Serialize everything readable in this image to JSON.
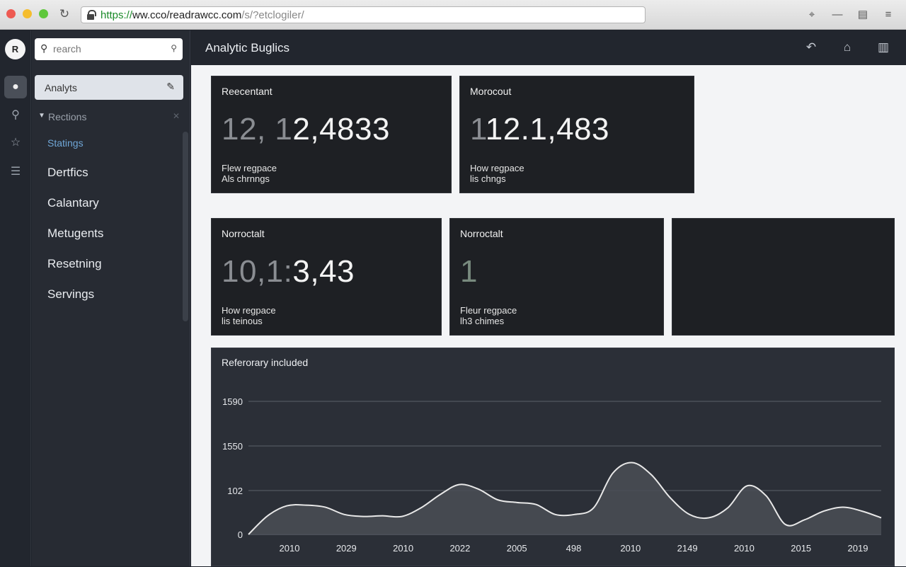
{
  "browser": {
    "url_protocol": "https://",
    "url_host": "ww.cco/readrawcc.com",
    "url_path": "/s/?etclogiler/",
    "icons": [
      "pin-icon",
      "minus-icon",
      "page-icon",
      "menu-icon"
    ]
  },
  "rail": {
    "avatar_label": "R",
    "items": [
      {
        "name": "apple-icon",
        "glyph": "●",
        "active": true
      },
      {
        "name": "key-icon",
        "glyph": "⚲",
        "active": false
      },
      {
        "name": "star-icon",
        "glyph": "☆",
        "active": false
      },
      {
        "name": "list-icon",
        "glyph": "☰",
        "active": false
      }
    ]
  },
  "sidebar": {
    "search_placeholder": "rearch",
    "active_item": "Analyts",
    "section": "Rections",
    "sub_item": "Statings",
    "items": [
      "Dertfics",
      "Calantary",
      "Metugents",
      "Resetning",
      "Servings"
    ]
  },
  "header": {
    "title": "Analytic Buglics",
    "icons": [
      "back-icon",
      "home-icon",
      "grid-icon"
    ]
  },
  "cards": [
    {
      "title": "Reecentant",
      "value_dim": "12, 1",
      "value_main": "2,4833",
      "sub1": "Flew regpace",
      "sub2": "Als chrnngs"
    },
    {
      "title": "Morocout",
      "value_dim": "1",
      "value_main": "12.1,483",
      "sub1": "How regpace",
      "sub2": "lis chngs"
    },
    {
      "title": "Norroctalt",
      "value_dim": "10,1:",
      "value_main": "3,43",
      "sub1": "How regpace",
      "sub2": "lis teinous"
    },
    {
      "title": "Norroctalt",
      "value_dim": "1",
      "value_main": "",
      "sub1": "Fleur regpace",
      "sub2": "lh3 chimes"
    },
    {
      "title": "",
      "value_dim": "",
      "value_main": "",
      "sub1": "",
      "sub2": ""
    }
  ],
  "chart_data": {
    "type": "area",
    "title": "Referorary included",
    "y_ticks": [
      "0",
      "102",
      "1550",
      "1590"
    ],
    "x_ticks": [
      "2010",
      "2029",
      "2010",
      "2022",
      "2005",
      "498",
      "2010",
      "2149",
      "2010",
      "2015",
      "2019"
    ],
    "values": [
      0,
      28,
      43,
      44,
      41,
      30,
      27,
      28,
      27,
      40,
      60,
      75,
      68,
      52,
      48,
      45,
      30,
      30,
      40,
      92,
      108,
      90,
      55,
      30,
      25,
      40,
      73,
      58,
      15,
      22,
      35,
      41,
      35,
      25
    ],
    "ylim": [
      0,
      200
    ],
    "grid": true,
    "line_color": "#e8e8e8",
    "fill_color": "#4a4e55"
  }
}
